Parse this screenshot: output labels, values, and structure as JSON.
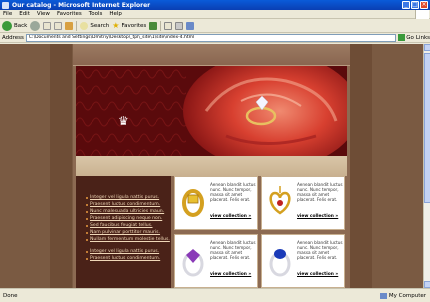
{
  "window": {
    "title": "Our catalog - Microsoft Internet Explorer"
  },
  "menubar": {
    "items": [
      "File",
      "Edit",
      "View",
      "Favorites",
      "Tools",
      "Help"
    ]
  },
  "toolbar": {
    "back_label": "Back",
    "search_label": "Search",
    "favorites_label": "Favorites"
  },
  "addressbar": {
    "label": "Address",
    "url": "C:\\Documents and Settings\\Dmitriy\\Desktop\\_tpl\\_site\\1\\site\\index-4.html",
    "go_label": "Go",
    "links_label": "Links"
  },
  "page": {
    "nav_items": [
      "Integer vel ligula nattis purus.",
      "Praesent luctus condimentum.",
      "Nunc malesuada ultricies maun.",
      "Praesent adipiscing neque non.",
      "Sed faucibus feugiat tellus.",
      "Nam pulvinar porttitor mauris.",
      "Nullam fermentum molestie tellus."
    ],
    "nav_items_2": [
      "Integer vel ligula nattis purus.",
      "Praesent luctus condimentum."
    ],
    "cards": [
      {
        "desc": "Aenean blandit luctus nunc. Nunc tempor, massa sit amet placerat. Felis erat.",
        "link": "view collection »"
      },
      {
        "desc": "Aenean blandit luctus nunc. Nunc tempor, massa sit amet placerat. Felis erat.",
        "link": "view collection »"
      },
      {
        "desc": "Aenean blandit luctus nunc. Nunc tempor, massa sit amet placerat. Felis erat.",
        "link": "view collection »"
      },
      {
        "desc": "Aenean blandit luctus nunc. Nunc tempor, massa sit amet placerat. Felis erat.",
        "link": "view collection »"
      }
    ]
  },
  "status": {
    "left": "Done",
    "zone": "My Computer"
  },
  "colors": {
    "titlebar": "#0a5bd9",
    "page_bg": "#7a5a42",
    "banner": "#6a0f12",
    "left_panel": "#4a2218"
  },
  "icons": {
    "back": "back-arrow-icon",
    "forward": "forward-arrow-icon",
    "stop": "stop-icon",
    "refresh": "refresh-icon",
    "home": "home-icon",
    "search": "search-icon",
    "favorites": "favorites-star-icon",
    "history": "history-icon",
    "mail": "mail-icon",
    "print": "print-icon",
    "go": "go-arrow-icon",
    "logo": "crown-logo-icon"
  }
}
